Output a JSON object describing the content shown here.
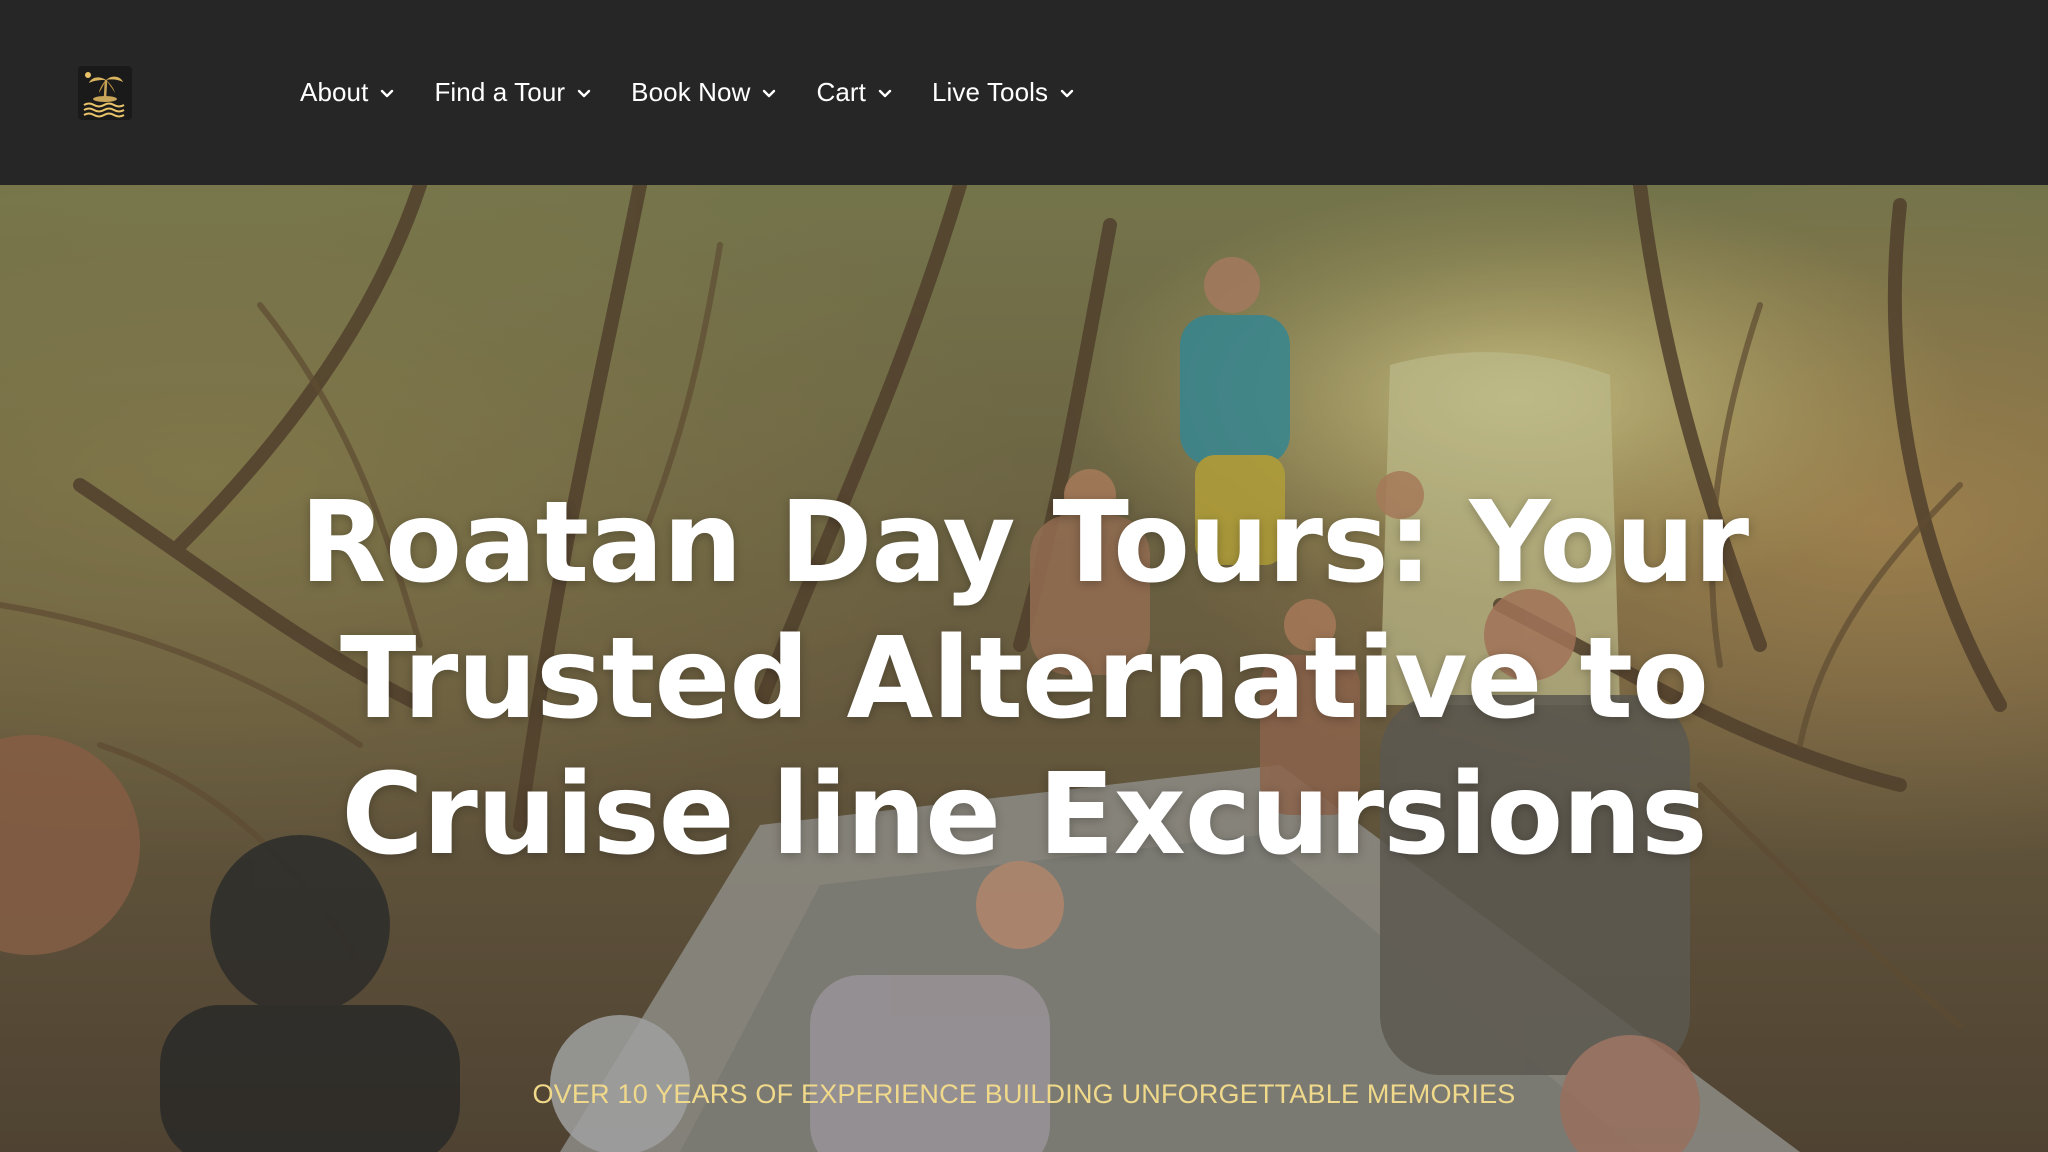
{
  "header": {
    "logo_icon": "palm-island-logo-icon",
    "nav": [
      {
        "label": "About",
        "icon": "chevron-down-icon"
      },
      {
        "label": "Find a Tour",
        "icon": "chevron-down-icon"
      },
      {
        "label": "Book Now",
        "icon": "chevron-down-icon"
      },
      {
        "label": "Cart",
        "icon": "chevron-down-icon"
      },
      {
        "label": "Live Tools",
        "icon": "chevron-down-icon"
      }
    ]
  },
  "hero": {
    "title": "Roatan Day Tours: Your Trusted Alternative to Cruise line Excursions",
    "subtitle": "OVER 10 YEARS OF EXPERIENCE BUILDING UNFORGETTABLE MEMORIES",
    "background_image": "mangrove-boat-tour-photo"
  },
  "colors": {
    "header_bg": "#262626",
    "nav_text": "#ffffff",
    "hero_title": "#ffffff",
    "hero_subtitle": "#f0d98a"
  }
}
